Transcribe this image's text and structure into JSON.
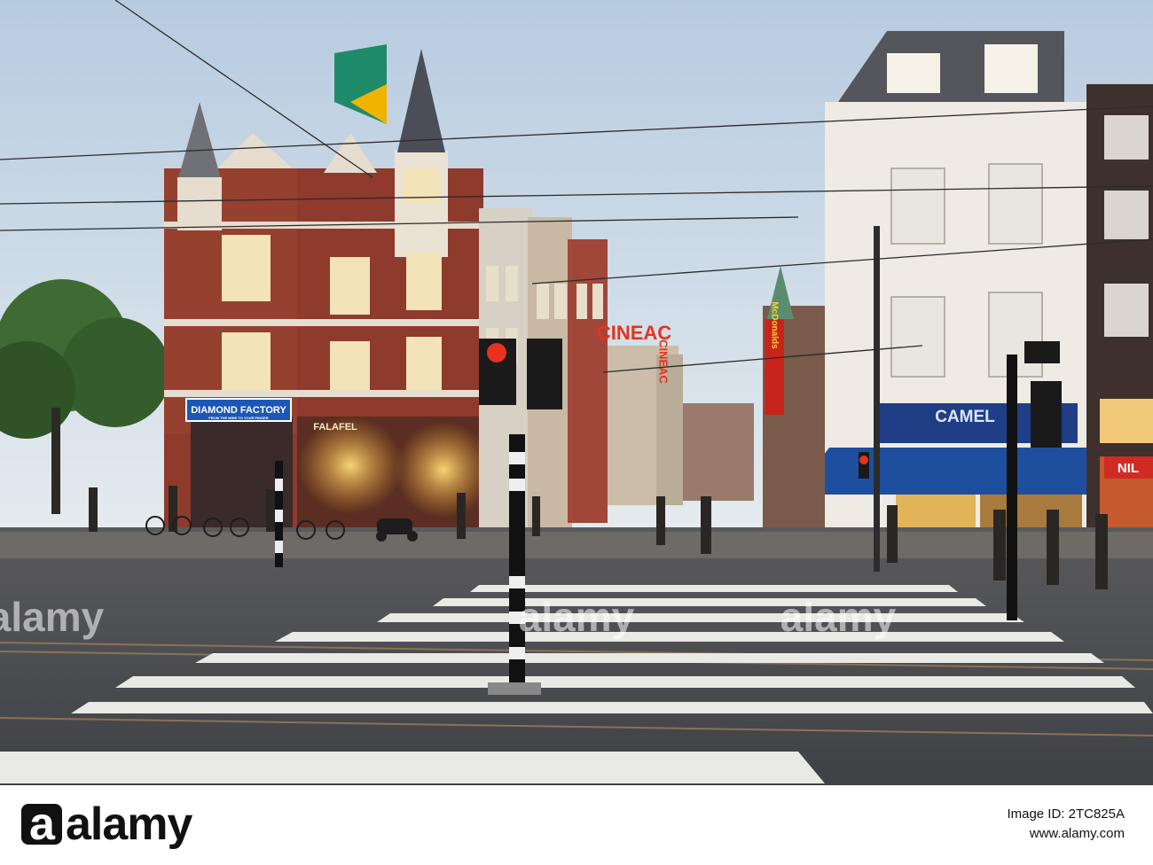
{
  "scene": {
    "signs": {
      "diamond_factory": "DIAMOND FACTORY",
      "diamond_factory_sub": "FROM THE MINE TO YOUR FINGER",
      "falafel": "FALAFEL",
      "cineac_horizontal": "CINEAC",
      "cineac_vertical": "CINEAC",
      "mcdonalds": "McDonalds",
      "camel": "CAMEL",
      "nil": "NIL"
    },
    "colors": {
      "sky_top": "#b7cbe0",
      "sky_bottom": "#e6ecef",
      "brick": "#8e3a2c",
      "awning_blue": "#1d4f9e",
      "bank_green": "#1f8a6a",
      "bank_yellow": "#f0b400",
      "neon_red": "#e8321e",
      "road": "#4e5054"
    }
  },
  "watermarks": {
    "left": "alamy",
    "center": "alamy",
    "right": "alamy"
  },
  "footer": {
    "logo_letter": "a",
    "logo_text": "alamy",
    "image_id_label": "Image ID: 2TC825A",
    "site": "www.alamy.com"
  }
}
